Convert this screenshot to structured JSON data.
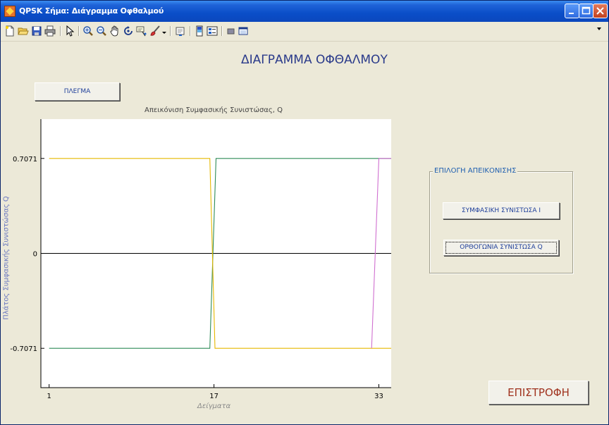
{
  "window": {
    "title": "QPSK Σήμα: Διάγραμμα Οφθαλμού"
  },
  "toolbar": {
    "tools": [
      "new-file-icon",
      "open-folder-icon",
      "save-icon",
      "print-icon",
      "pointer-icon",
      "zoom-in-icon",
      "zoom-out-icon",
      "pan-icon",
      "rotate-3d-icon",
      "data-cursor-icon",
      "brush-icon",
      "link-plot-icon",
      "colorbar-icon",
      "legend-icon",
      "hide-plot-tools-icon",
      "show-plot-tools-icon"
    ]
  },
  "heading": "ΔΙΑΓΡΑΜΜΑ ΟΦΘΑΛΜΟΥ",
  "grid_button": "ΠΛΕΓΜΑ",
  "plot": {
    "title": "Απεικόνιση Συμφασικής Συνιστώσας, Q",
    "ylabel": "Πλάτος Συμφασικής Συνιστώσας Q",
    "xlabel": "Δείγματα",
    "yticks": [
      "0.7071",
      "0",
      "-0.7071"
    ],
    "xticks": [
      "1",
      "17",
      "33"
    ]
  },
  "chart_data": {
    "type": "line",
    "title": "Απεικόνιση Συμφασικής Συνιστώσας, Q",
    "xlabel": "Δείγματα",
    "ylabel": "Πλάτος Συμφασικής Συνιστώσας Q",
    "xlim": [
      0.2,
      34.2
    ],
    "ylim": [
      -1.0,
      1.0
    ],
    "grid": false,
    "series": [
      {
        "color": "#2e8b57",
        "points": [
          [
            1,
            -0.7071
          ],
          [
            16.6,
            -0.7071
          ],
          [
            17.2,
            0.7071
          ],
          [
            34.2,
            0.7071
          ]
        ]
      },
      {
        "color": "#e6b800",
        "points": [
          [
            1,
            0.7071
          ],
          [
            16.6,
            0.7071
          ],
          [
            17.1,
            -0.7071
          ],
          [
            34.2,
            -0.7071
          ]
        ]
      },
      {
        "color": "#d070d0",
        "points": [
          [
            32.3,
            -0.7071
          ],
          [
            33.0,
            0.7071
          ],
          [
            34.2,
            0.7071
          ]
        ]
      }
    ],
    "reference_lines": [
      {
        "y": 0,
        "color": "#000000"
      }
    ]
  },
  "panel": {
    "title": "ΕΠΙΛΟΓΗ ΑΠΕΙΚΟΝΙΣΗΣ",
    "button_i": "ΣΥΜΦΑΣΙΚΗ ΣΥΝΙΣΤΩΣΑ Ι",
    "button_q": "ΟΡΘΟΓΩΝΙΑ ΣΥΝΙΣΤΩΣΑ Q"
  },
  "back_button": "ΕΠΙΣΤΡΟΦΗ"
}
